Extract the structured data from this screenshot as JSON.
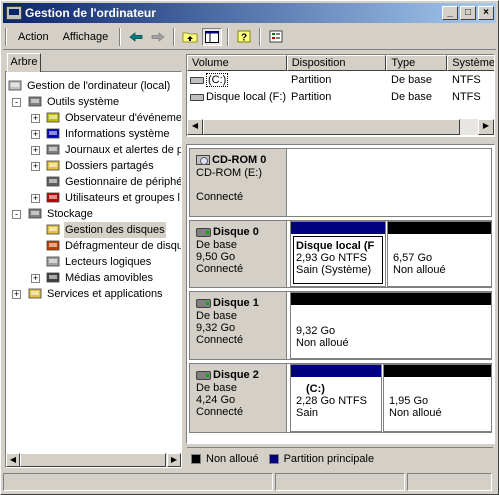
{
  "window": {
    "title": "Gestion de l'ordinateur"
  },
  "titlebar_buttons": {
    "minimize": "_",
    "maximize": "□",
    "close": "×"
  },
  "menu": {
    "action": "Action",
    "view": "Affichage"
  },
  "toolbar": {
    "back_icon": "back-arrow-icon",
    "forward_icon": "forward-arrow-icon",
    "up_icon": "up-folder-icon",
    "tree_icon": "show-tree-icon",
    "help_icon": "help-icon",
    "properties_icon": "properties-icon"
  },
  "left": {
    "tab_label": "Arbre",
    "tree": [
      {
        "label": "Gestion de l'ordinateur (local)",
        "icon": "computer-icon"
      },
      {
        "label": "Outils système",
        "icon": "tools-icon",
        "expander": "-"
      },
      {
        "label": "Observateur d'événeme",
        "icon": "event-viewer-icon",
        "expander": "+"
      },
      {
        "label": "Informations système",
        "icon": "system-info-icon",
        "expander": "+"
      },
      {
        "label": "Journaux et alertes de p",
        "icon": "logs-icon",
        "expander": "+"
      },
      {
        "label": "Dossiers partagés",
        "icon": "shared-folder-icon",
        "expander": "+"
      },
      {
        "label": "Gestionnaire de périphé",
        "icon": "device-manager-icon"
      },
      {
        "label": "Utilisateurs et groupes l",
        "icon": "users-icon",
        "expander": "+"
      },
      {
        "label": "Stockage",
        "icon": "storage-icon",
        "expander": "-"
      },
      {
        "label": "Gestion des disques",
        "icon": "disk-management-icon"
      },
      {
        "label": "Défragmenteur de disqu",
        "icon": "defrag-icon"
      },
      {
        "label": "Lecteurs logiques",
        "icon": "logical-drives-icon"
      },
      {
        "label": "Médias amovibles",
        "icon": "removable-media-icon",
        "expander": "+"
      },
      {
        "label": "Services et applications",
        "icon": "services-icon",
        "expander": "+"
      }
    ]
  },
  "volume_list": {
    "columns": [
      "Volume",
      "Disposition",
      "Type",
      "Système"
    ],
    "rows": [
      {
        "volume": "(C:)",
        "disposition": "Partition",
        "type": "De base",
        "system": "NTFS"
      },
      {
        "volume": "Disque local (F:)",
        "disposition": "Partition",
        "type": "De base",
        "system": "NTFS"
      }
    ]
  },
  "disks": [
    {
      "name": "CD-ROM 0",
      "line1": "CD-ROM (E:)",
      "line2": "",
      "line3": "Connecté",
      "partitions": []
    },
    {
      "name": "Disque 0",
      "line1": "De base",
      "line2": "9,50 Go",
      "line3": "Connecté",
      "partitions": [
        {
          "title": "Disque local  (F",
          "l1": "2,93 Go NTFS",
          "l2": "Sain (Système)",
          "kind": "primary"
        },
        {
          "title": "",
          "l1": "6,57 Go",
          "l2": "Non alloué",
          "kind": "unallocated"
        }
      ]
    },
    {
      "name": "Disque 1",
      "line1": "De base",
      "line2": "9,32 Go",
      "line3": "Connecté",
      "partitions": [
        {
          "title": "",
          "l1": "9,32 Go",
          "l2": "Non alloué",
          "kind": "unallocated"
        }
      ]
    },
    {
      "name": "Disque 2",
      "line1": "De base",
      "line2": "4,24 Go",
      "line3": "Connecté",
      "partitions": [
        {
          "title": "(C:)",
          "l1": "2,28 Go NTFS",
          "l2": "Sain",
          "kind": "primary"
        },
        {
          "title": "",
          "l1": "1,95 Go",
          "l2": "Non alloué",
          "kind": "unallocated"
        }
      ]
    }
  ],
  "legend": {
    "unallocated": "Non alloué",
    "primary": "Partition principale"
  },
  "colors": {
    "unallocated": "#000000",
    "primary": "#000080",
    "title_start": "#0a246a",
    "title_end": "#a6caf0"
  }
}
